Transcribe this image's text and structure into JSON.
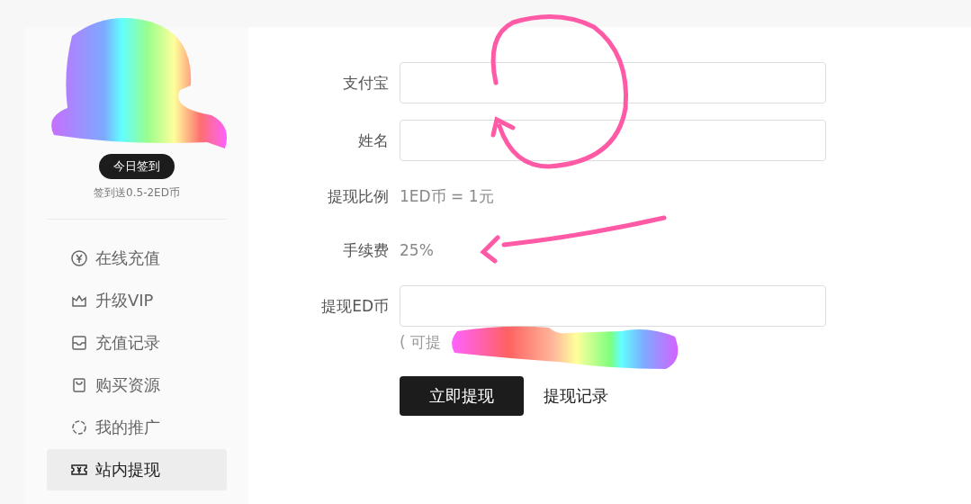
{
  "sidebar": {
    "checkin_button": "今日签到",
    "checkin_note": "签到送0.5-2ED币",
    "menu": [
      {
        "label": "在线充值",
        "selected": false
      },
      {
        "label": "升级VIP",
        "selected": false
      },
      {
        "label": "充值记录",
        "selected": false
      },
      {
        "label": "购买资源",
        "selected": false
      },
      {
        "label": "我的推广",
        "selected": false
      },
      {
        "label": "站内提现",
        "selected": true
      }
    ]
  },
  "form": {
    "rows": [
      {
        "kind": "input",
        "label": "支付宝"
      },
      {
        "kind": "input",
        "label": "姓名"
      },
      {
        "kind": "text",
        "label": "提现比例",
        "value": "1ED币 = 1元"
      },
      {
        "kind": "text",
        "label": "手续费",
        "value": "25%"
      },
      {
        "kind": "input",
        "label": "提现ED币",
        "hint": "( 可提"
      }
    ],
    "submit_button": "立即提现",
    "records_link": "提现记录"
  }
}
